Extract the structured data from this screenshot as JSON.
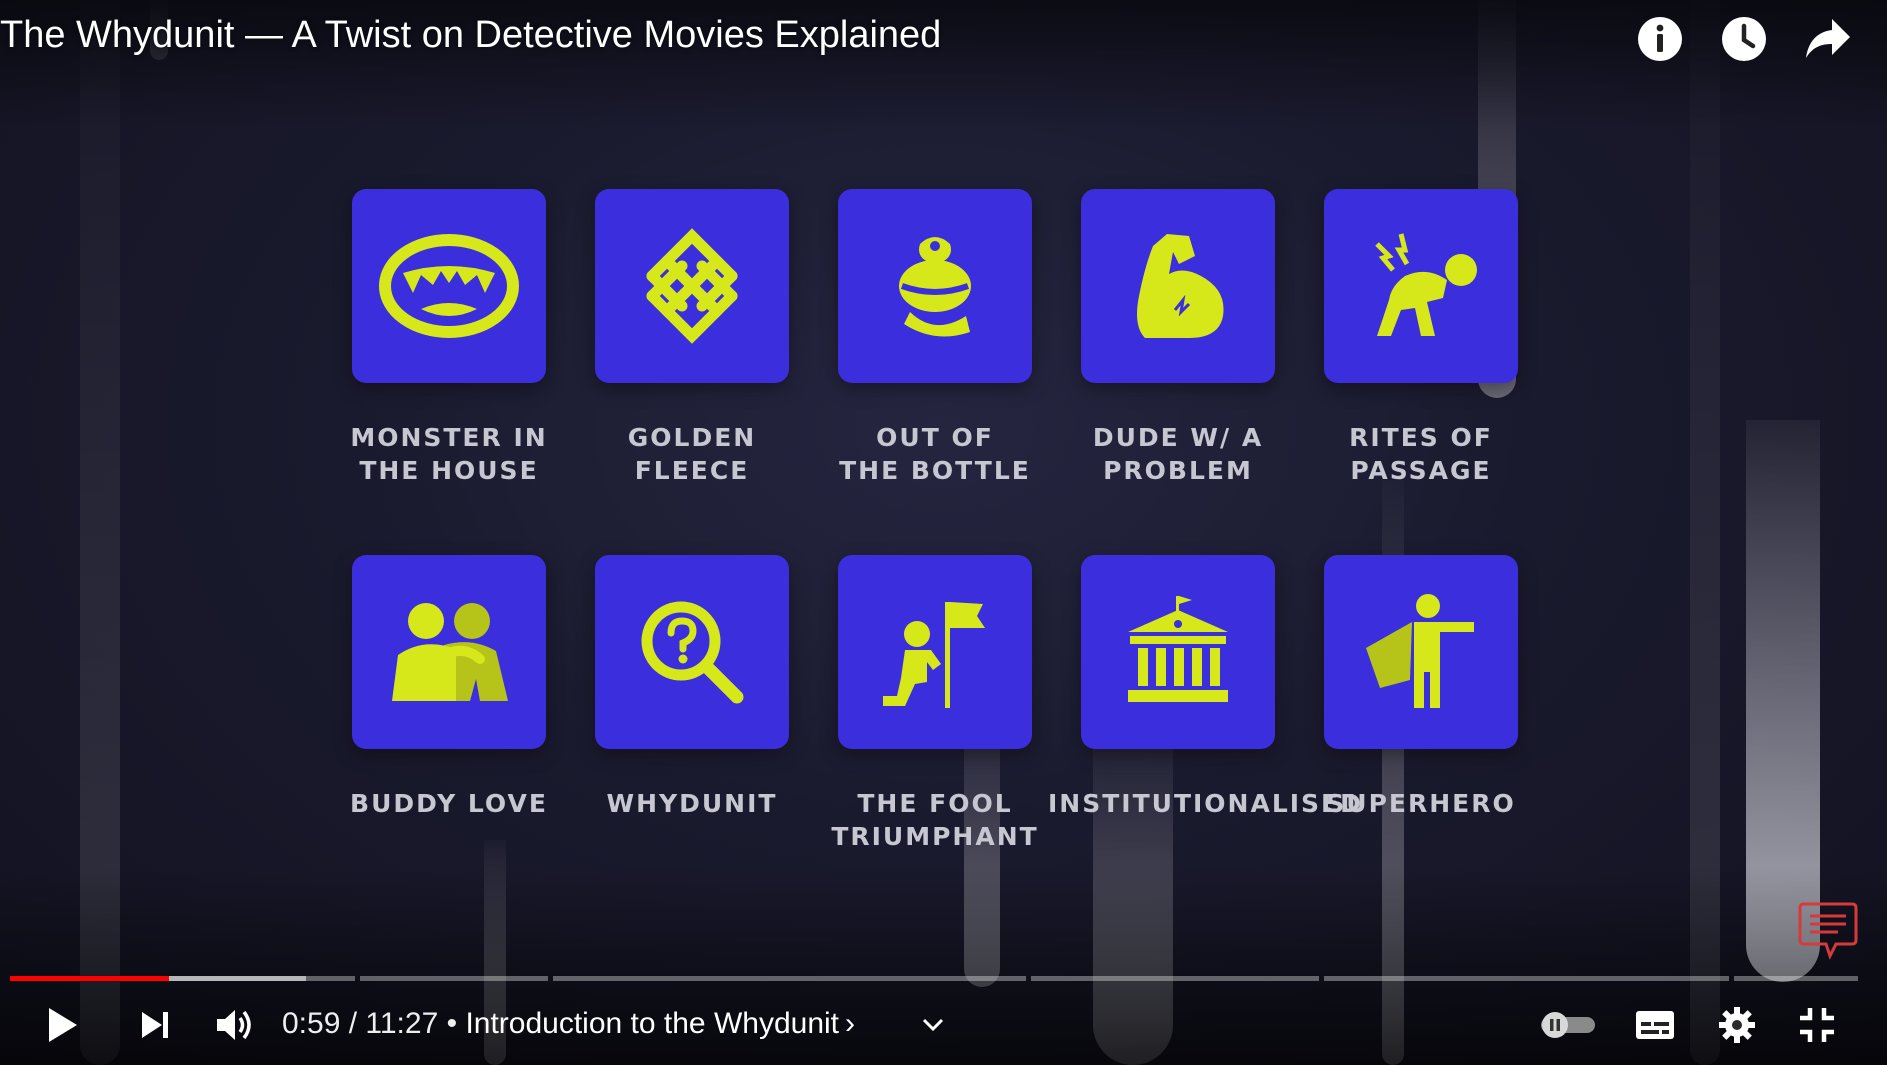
{
  "video": {
    "title": "The Whydunit — A Twist on Detective Movies Explained"
  },
  "top_actions": [
    {
      "name": "info-icon"
    },
    {
      "name": "watch-later-icon"
    },
    {
      "name": "share-icon"
    }
  ],
  "tiles": [
    {
      "label": "MONSTER IN\nTHE HOUSE",
      "icon": "fanged-mouth-icon"
    },
    {
      "label": "GOLDEN\nFLEECE",
      "icon": "celtic-knot-icon"
    },
    {
      "label": "OUT OF\nTHE BOTTLE",
      "icon": "genie-icon"
    },
    {
      "label": "DUDE W/ A\nPROBLEM",
      "icon": "flexed-arm-icon"
    },
    {
      "label": "RITES OF\nPASSAGE",
      "icon": "crawling-person-icon"
    },
    {
      "label": "BUDDY LOVE",
      "icon": "two-friends-icon"
    },
    {
      "label": "WHYDUNIT",
      "icon": "magnifier-question-icon"
    },
    {
      "label": "THE FOOL\nTRIUMPHANT",
      "icon": "person-with-flag-icon"
    },
    {
      "label": "INSTITUTIONALISED",
      "icon": "institution-building-icon"
    },
    {
      "label": "SUPERHERO",
      "icon": "caped-hero-icon"
    }
  ],
  "player": {
    "current_time": "0:59",
    "duration": "11:27",
    "time_separator": " / ",
    "chapter_prefix": " • ",
    "chapter_title": "Introduction to the Whydunit",
    "chapter_chevron": "›",
    "progress_fraction": 0.086,
    "buffered_fraction": 0.16
  },
  "colors": {
    "tile": "#3b2edc",
    "icon": "#d6e81a",
    "progress_played": "#ff0000"
  }
}
